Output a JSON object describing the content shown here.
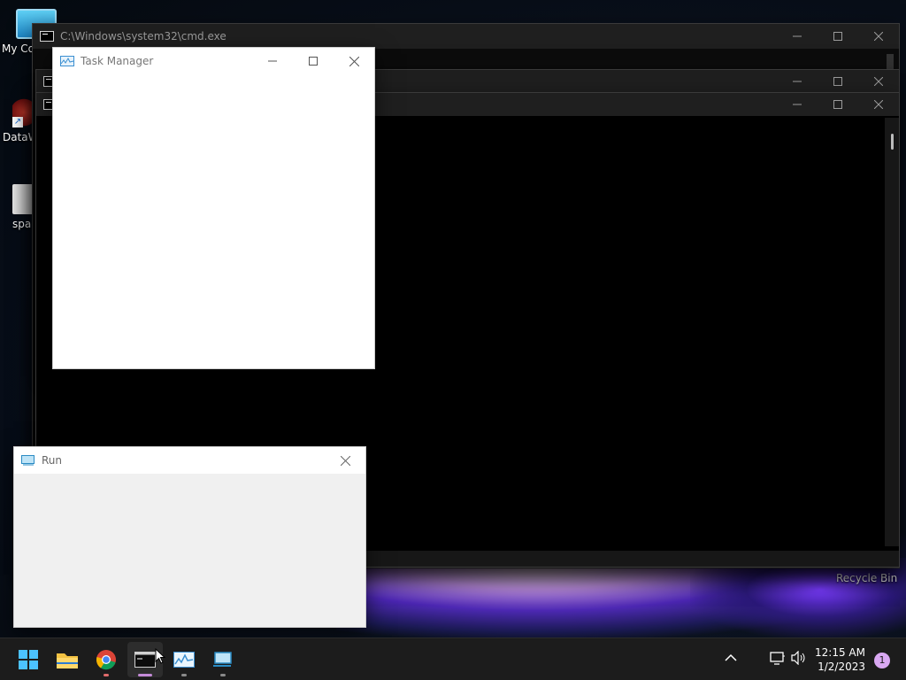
{
  "desktop": {
    "icons": [
      {
        "label": "My Co",
        "icon": "computer-icon"
      },
      {
        "label": "DataW",
        "icon": "dataw-shortcut-icon"
      },
      {
        "label": "spa",
        "icon": "file-icon"
      }
    ],
    "recycle_bin_label": "Recycle Bin"
  },
  "cmd_windows": [
    {
      "title": "C:\\Windows\\system32\\cmd.exe"
    },
    {
      "title": ""
    },
    {
      "title": ""
    }
  ],
  "task_manager": {
    "title": "Task Manager"
  },
  "run_dialog": {
    "title": "Run"
  },
  "taskbar": {
    "apps": [
      {
        "name": "start",
        "icon": "windows-start-icon"
      },
      {
        "name": "file-explorer",
        "icon": "folder-icon"
      },
      {
        "name": "chrome",
        "icon": "chrome-icon"
      },
      {
        "name": "command-prompt",
        "icon": "cmd-icon"
      },
      {
        "name": "task-manager",
        "icon": "task-manager-icon"
      },
      {
        "name": "run",
        "icon": "run-icon"
      }
    ],
    "clock": {
      "time": "12:15 AM",
      "date": "1/2/2023"
    },
    "notification_count": "1"
  },
  "colors": {
    "accent": "#c48bd8",
    "taskbar": "#1c1c1c",
    "cmd_title": "#1f1f1f"
  }
}
